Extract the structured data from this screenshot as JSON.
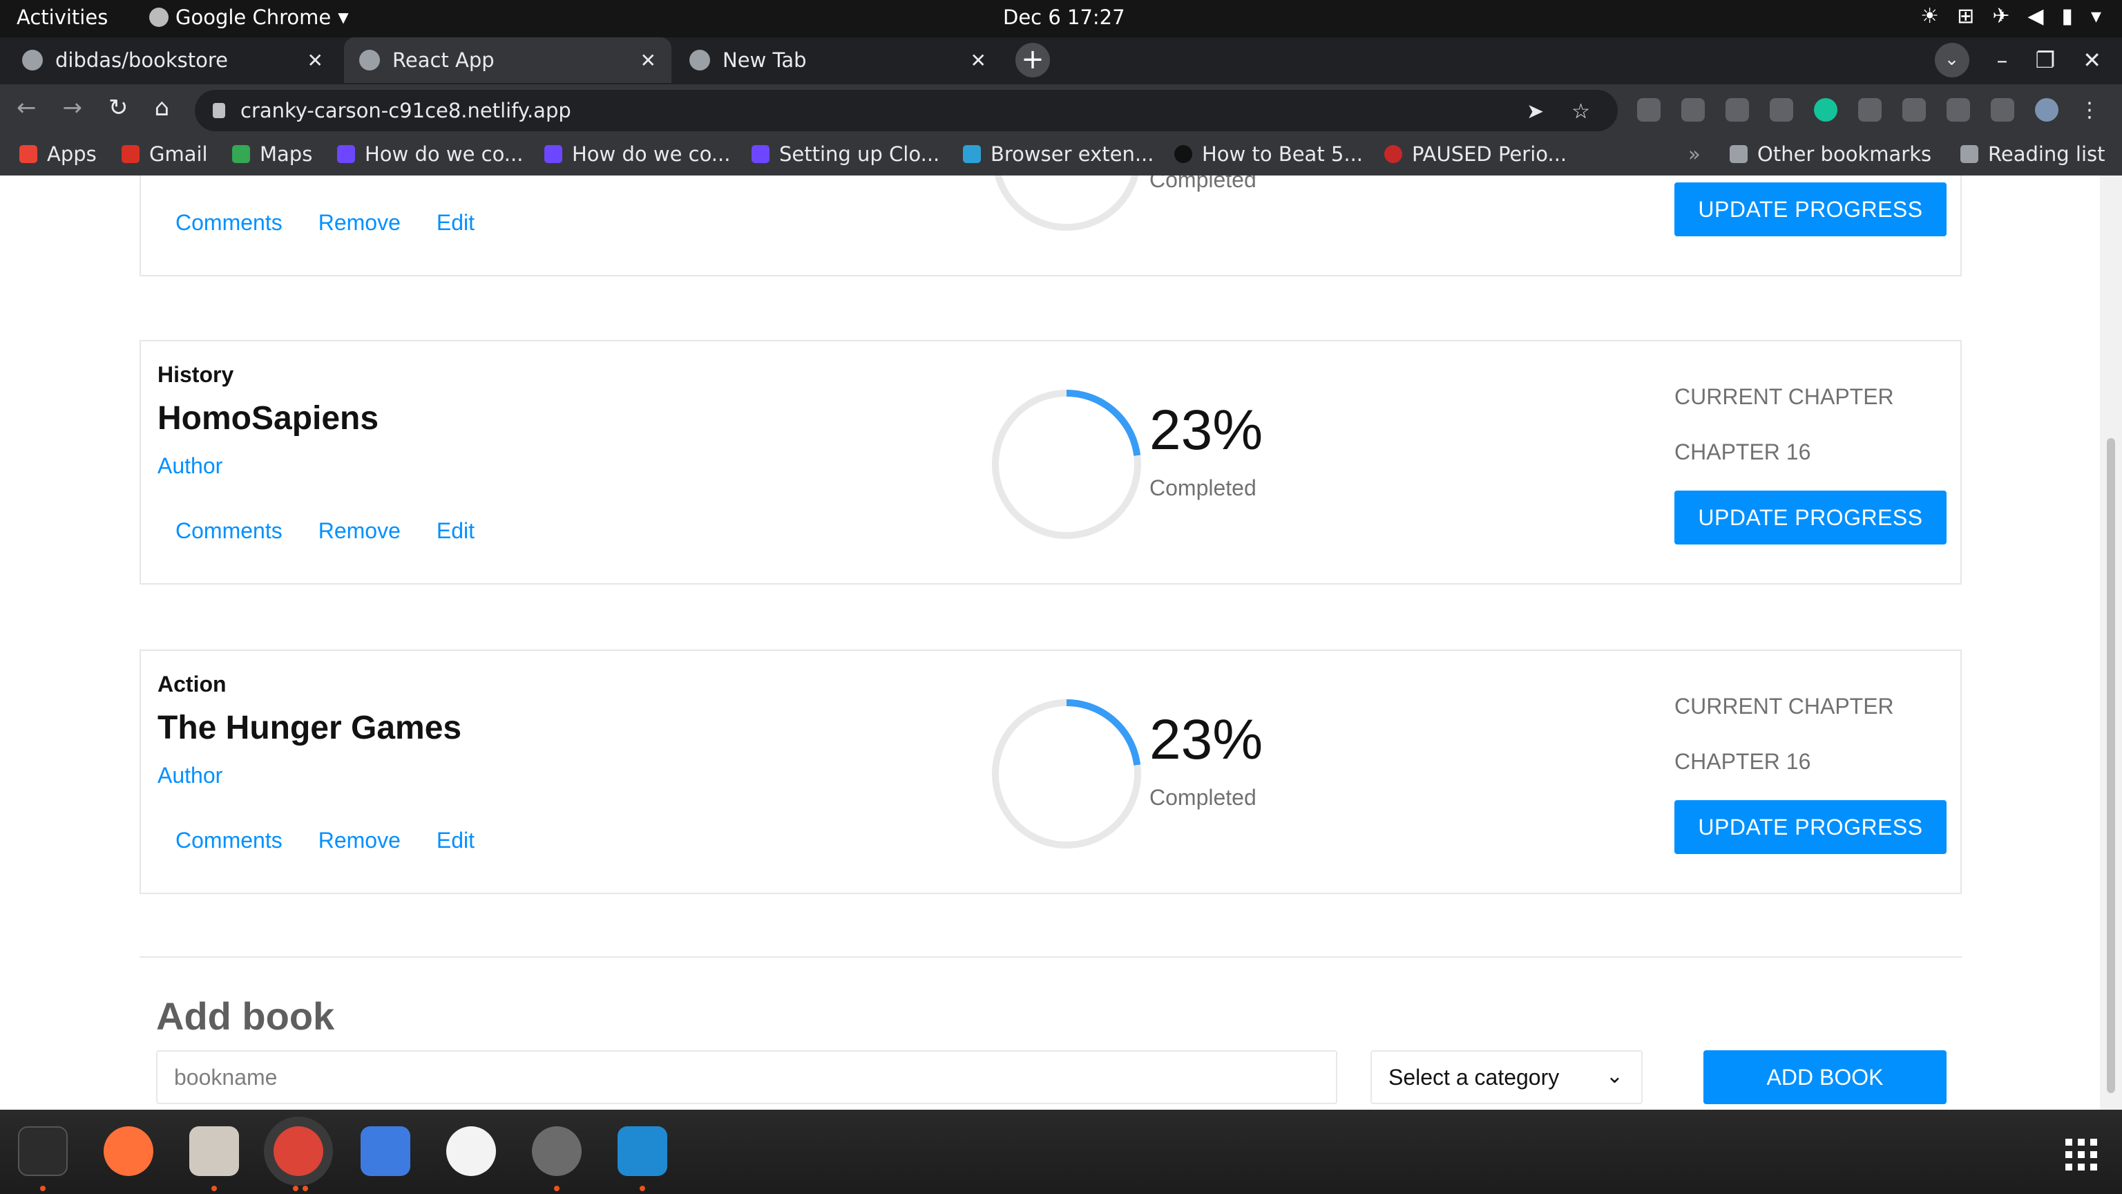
{
  "system_bar": {
    "activities": "Activities",
    "app_name": "Google Chrome",
    "clock": "Dec 6  17:27"
  },
  "browser": {
    "tabs": [
      {
        "label": "dibdas/bookstore",
        "state": "inactive"
      },
      {
        "label": "React App",
        "state": "active"
      },
      {
        "label": "New Tab",
        "state": "inactive"
      }
    ],
    "url": "cranky-carson-c91ce8.netlify.app",
    "bookmarks": [
      {
        "label": "Apps"
      },
      {
        "label": "Gmail"
      },
      {
        "label": "Maps"
      },
      {
        "label": "How do we co..."
      },
      {
        "label": "How do we co..."
      },
      {
        "label": "Setting up Clo..."
      },
      {
        "label": "Browser exten..."
      },
      {
        "label": "How to Beat 5..."
      },
      {
        "label": "PAUSED Perio..."
      }
    ],
    "other_bookmarks": "Other bookmarks",
    "reading_list": "Reading list"
  },
  "page": {
    "top_card": {
      "done_label": "Completed",
      "actions": {
        "comments": "Comments",
        "remove": "Remove",
        "edit": "Edit"
      },
      "update_label": "UPDATE PROGRESS"
    },
    "books": [
      {
        "category": "History",
        "title": "HomoSapiens",
        "author": "Author",
        "percent": 23,
        "percent_label": "23%",
        "done_label": "Completed",
        "current_label": "CURRENT CHAPTER",
        "chapter": "CHAPTER 16",
        "update_label": "UPDATE PROGRESS",
        "actions": {
          "comments": "Comments",
          "remove": "Remove",
          "edit": "Edit"
        }
      },
      {
        "category": "Action",
        "title": "The Hunger Games",
        "author": "Author",
        "percent": 23,
        "percent_label": "23%",
        "done_label": "Completed",
        "current_label": "CURRENT CHAPTER",
        "chapter": "CHAPTER 16",
        "update_label": "UPDATE PROGRESS",
        "actions": {
          "comments": "Comments",
          "remove": "Remove",
          "edit": "Edit"
        }
      }
    ],
    "add_form": {
      "title": "Add book",
      "input_placeholder": "bookname",
      "category_select": "Select a category",
      "submit_label": "ADD BOOK"
    }
  },
  "colors": {
    "accent": "#0290ff",
    "ring": "#379cf6",
    "ring_track": "#e8e8e8"
  }
}
